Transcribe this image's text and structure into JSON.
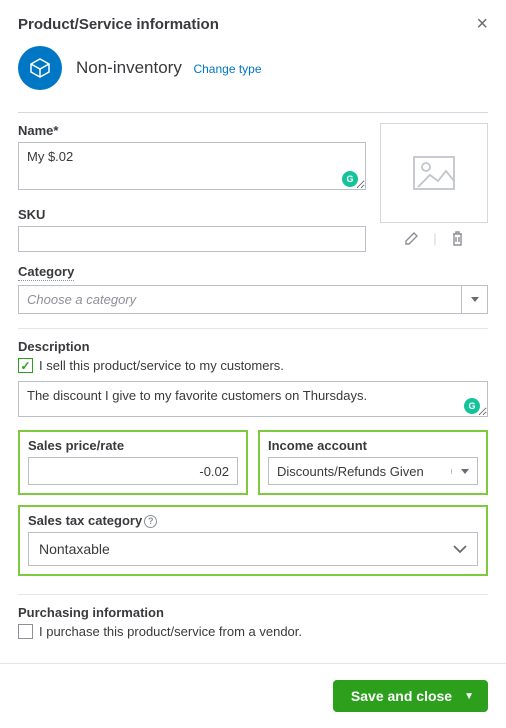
{
  "header": {
    "title": "Product/Service information"
  },
  "type": {
    "name": "Non-inventory",
    "change_link": "Change type"
  },
  "name_section": {
    "label": "Name*",
    "value": "My $.02"
  },
  "sku_section": {
    "label": "SKU",
    "value": ""
  },
  "category_section": {
    "label": "Category",
    "placeholder": "Choose a category"
  },
  "description_section": {
    "label": "Description",
    "checkbox_label": "I sell this product/service to my customers.",
    "value": "The discount I give to my favorite customers on Thursdays."
  },
  "sales_price": {
    "label": "Sales price/rate",
    "value": "-0.02"
  },
  "income_account": {
    "label": "Income account",
    "value": "Discounts/Refunds Given"
  },
  "sales_tax": {
    "label": "Sales tax category",
    "value": "Nontaxable"
  },
  "purchasing": {
    "label": "Purchasing information",
    "checkbox_label": "I purchase this product/service from a vendor."
  },
  "footer": {
    "save_label": "Save and close"
  }
}
